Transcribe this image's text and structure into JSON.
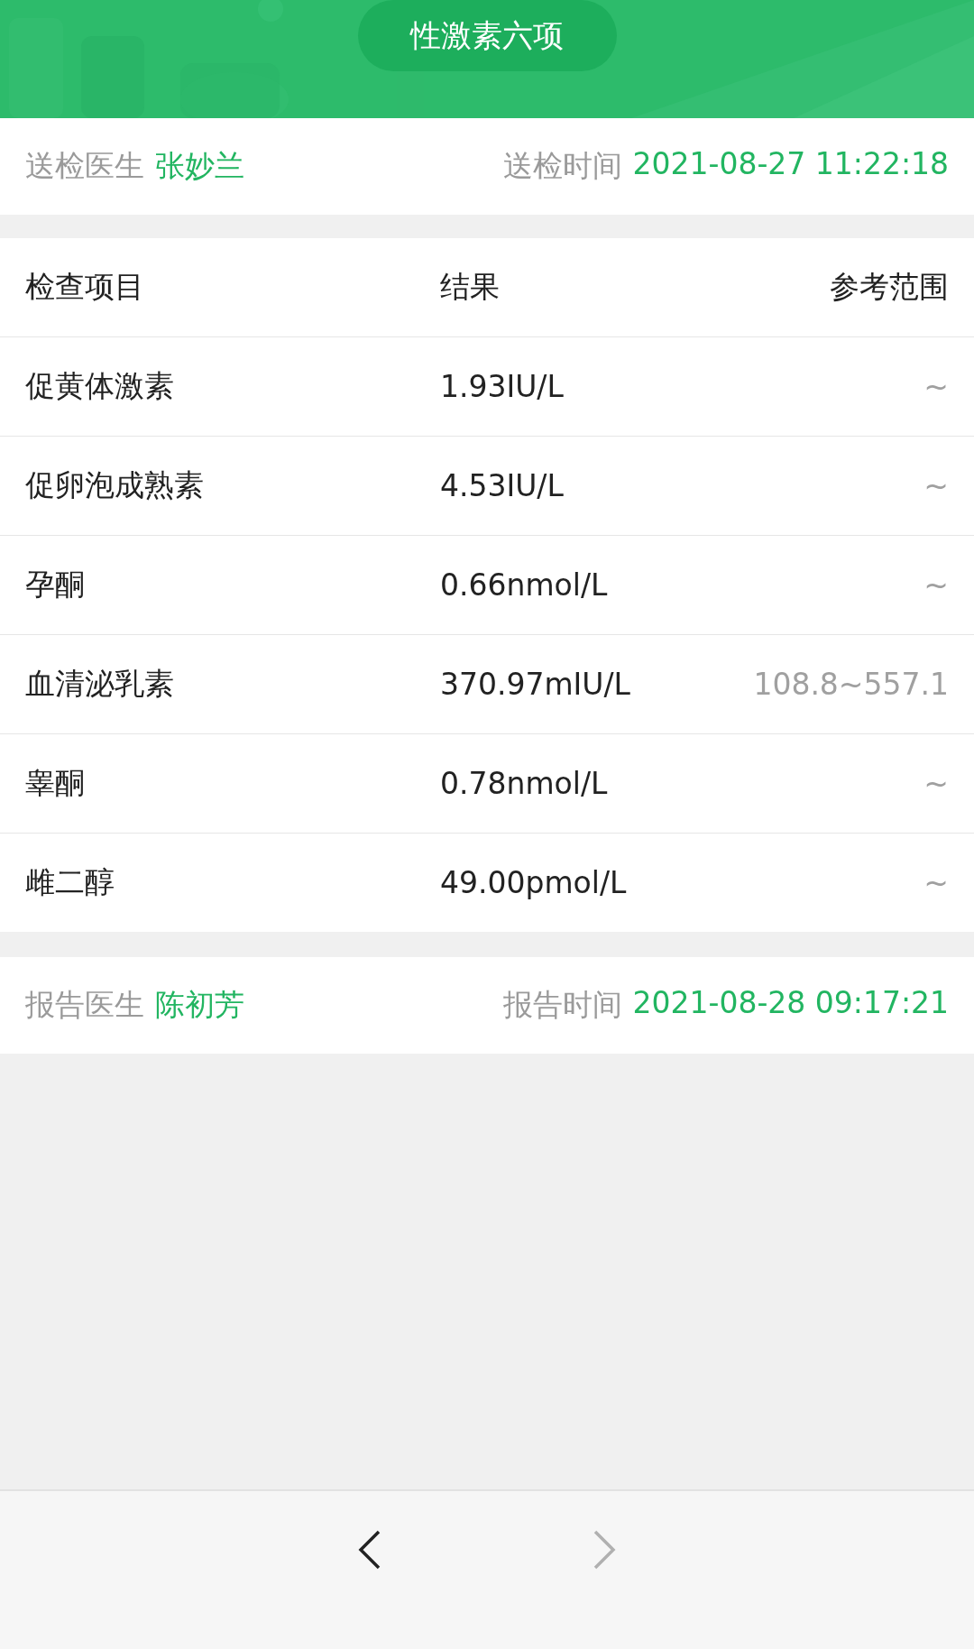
{
  "header": {
    "title": "性激素六项"
  },
  "submit_info": {
    "doctor_label": "送检医生",
    "doctor": "张妙兰",
    "time_label": "送检时间",
    "time": "2021-08-27 11:22:18"
  },
  "table": {
    "columns": [
      "检查项目",
      "结果",
      "参考范围"
    ],
    "rows": [
      {
        "item": "促黄体激素",
        "result": "1.93IU/L",
        "range": "~"
      },
      {
        "item": "促卵泡成熟素",
        "result": "4.53IU/L",
        "range": "~"
      },
      {
        "item": "孕酮",
        "result": "0.66nmol/L",
        "range": "~"
      },
      {
        "item": "血清泌乳素",
        "result": "370.97mIU/L",
        "range": "108.8~557.1"
      },
      {
        "item": "睾酮",
        "result": "0.78nmol/L",
        "range": "~"
      },
      {
        "item": "雌二醇",
        "result": "49.00pmol/L",
        "range": "~"
      }
    ]
  },
  "report_info": {
    "doctor_label": "报告医生",
    "doctor": "陈初芳",
    "time_label": "报告时间",
    "time": "2021-08-28 09:17:21"
  },
  "nav": {
    "back_disabled": false,
    "forward_disabled": true
  }
}
